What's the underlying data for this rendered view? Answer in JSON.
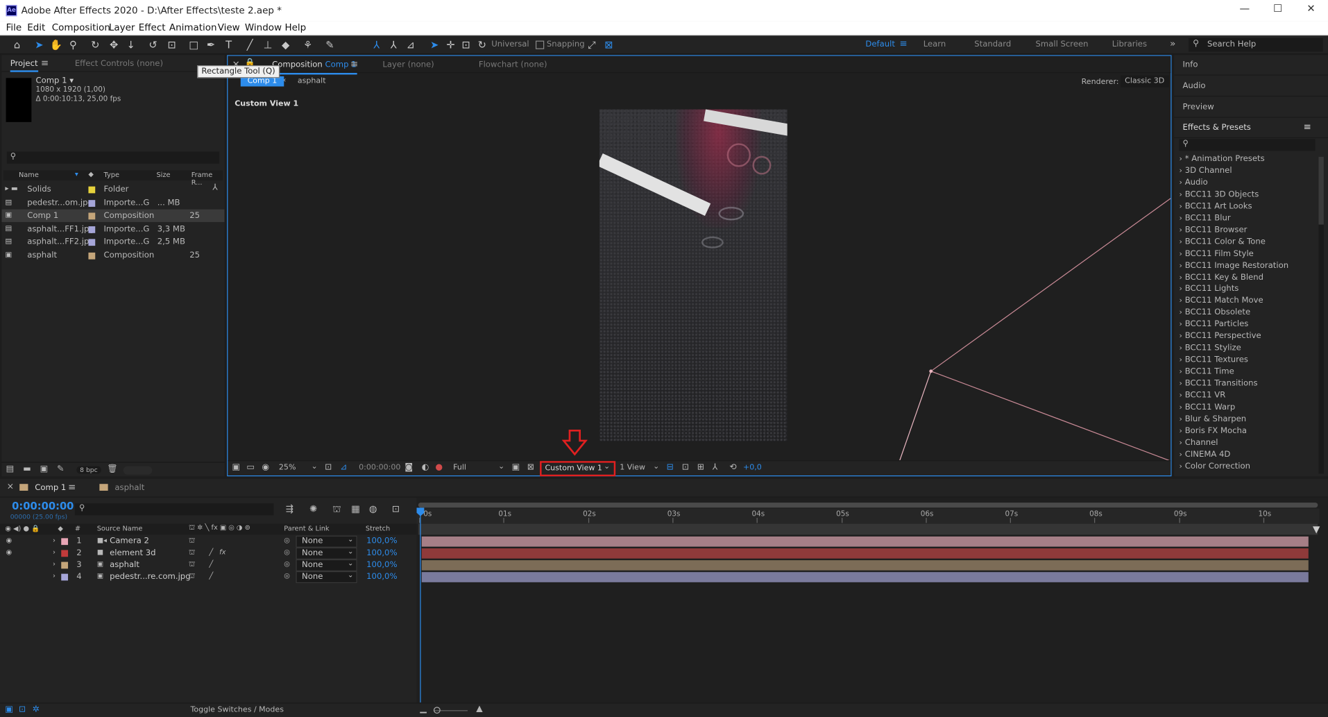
{
  "app": {
    "title": "Adobe After Effects 2020 - D:\\After Effects\\teste 2.aep *",
    "logo": "Ae",
    "window_buttons": [
      "—",
      "☐",
      "✕"
    ]
  },
  "menu": [
    "File",
    "Edit",
    "Composition",
    "Layer",
    "Effect",
    "Animation",
    "View",
    "Window",
    "Help"
  ],
  "toolbar": {
    "tooltip": "Rectangle Tool (Q)",
    "universal_label": "Universal",
    "snapping_label": "Snapping",
    "workspaces": [
      "Default",
      "Learn",
      "Standard",
      "Small Screen",
      "Libraries"
    ],
    "active_workspace": "Default",
    "search_placeholder": "Search Help"
  },
  "project": {
    "tab": "Project",
    "effect_controls_tab": "Effect Controls (none)",
    "comp_name": "Comp 1 ▾",
    "comp_res": "1080 x 1920 (1,00)",
    "comp_dur": "Δ 0:00:10:13, 25,00 fps",
    "columns": [
      "Name",
      "Type",
      "Size",
      "Frame R..."
    ],
    "items": [
      {
        "name": "Solids",
        "type": "Folder",
        "size": "",
        "fr": "",
        "color": "#e6d23c"
      },
      {
        "name": "pedestr...om.jpg",
        "type": "Importe...G",
        "size": "... MB",
        "fr": "",
        "color": "#a5a5d8"
      },
      {
        "name": "Comp 1",
        "type": "Composition",
        "size": "",
        "fr": "25",
        "color": "#c4a57a"
      },
      {
        "name": "asphalt...FF1.jpg",
        "type": "Importe...G",
        "size": "3,3 MB",
        "fr": "",
        "color": "#a5a5d8"
      },
      {
        "name": "asphalt...FF2.jpg",
        "type": "Importe...G",
        "size": "2,5 MB",
        "fr": "",
        "color": "#a5a5d8"
      },
      {
        "name": "asphalt",
        "type": "Composition",
        "size": "",
        "fr": "25",
        "color": "#c4a57a"
      }
    ],
    "bpc": "8 bpc"
  },
  "viewer": {
    "tab_prefix": "Composition",
    "tab_comp": "Comp 1",
    "layer_tab": "Layer (none)",
    "flowchart_tab": "Flowchart (none)",
    "breadcrumb_comp": "Comp 1",
    "breadcrumb_asphalt": "asphalt",
    "renderer_label": "Renderer:",
    "renderer_value": "Classic 3D",
    "view_label": "Custom View 1",
    "zoom": "25%",
    "timecode": "0:00:00:00",
    "resolution": "Full",
    "active_view": "Custom View 1",
    "view_count": "1 View",
    "exposure": "+0,0"
  },
  "right_panel": {
    "sections": [
      "Info",
      "Audio",
      "Preview",
      "Effects & Presets"
    ],
    "effects": [
      "* Animation Presets",
      "3D Channel",
      "Audio",
      "BCC11 3D Objects",
      "BCC11 Art Looks",
      "BCC11 Blur",
      "BCC11 Browser",
      "BCC11 Color & Tone",
      "BCC11 Film Style",
      "BCC11 Image Restoration",
      "BCC11 Key & Blend",
      "BCC11 Lights",
      "BCC11 Match Move",
      "BCC11 Obsolete",
      "BCC11 Particles",
      "BCC11 Perspective",
      "BCC11 Stylize",
      "BCC11 Textures",
      "BCC11 Time",
      "BCC11 Transitions",
      "BCC11 VR",
      "BCC11 Warp",
      "Blur & Sharpen",
      "Boris FX Mocha",
      "Channel",
      "CINEMA 4D",
      "Color Correction"
    ]
  },
  "timeline": {
    "tab": "Comp 1",
    "tab2": "asphalt",
    "timecode": "0:00:00:00",
    "frames": "00000 (25.00 fps)",
    "columns": {
      "num": "#",
      "source": "Source Name",
      "parent": "Parent & Link",
      "stretch": "Stretch"
    },
    "ruler": [
      "0s",
      "01s",
      "02s",
      "03s",
      "04s",
      "05s",
      "06s",
      "07s",
      "08s",
      "09s",
      "10s"
    ],
    "layers": [
      {
        "num": "1",
        "name": "Camera 2",
        "color": "#e8a5b5",
        "parent": "None",
        "stretch": "100,0%",
        "bar": "#a67f87"
      },
      {
        "num": "2",
        "name": "element 3d",
        "color": "#c23b3b",
        "parent": "None",
        "stretch": "100,0%",
        "bar": "#8f3a3a"
      },
      {
        "num": "3",
        "name": "asphalt",
        "color": "#c4a57a",
        "parent": "None",
        "stretch": "100,0%",
        "bar": "#7c6c57"
      },
      {
        "num": "4",
        "name": "pedestr...re.com.jpg",
        "color": "#a5a5d8",
        "parent": "None",
        "stretch": "100,0%",
        "bar": "#7a7a9c"
      }
    ],
    "toggle_label": "Toggle Switches / Modes"
  }
}
